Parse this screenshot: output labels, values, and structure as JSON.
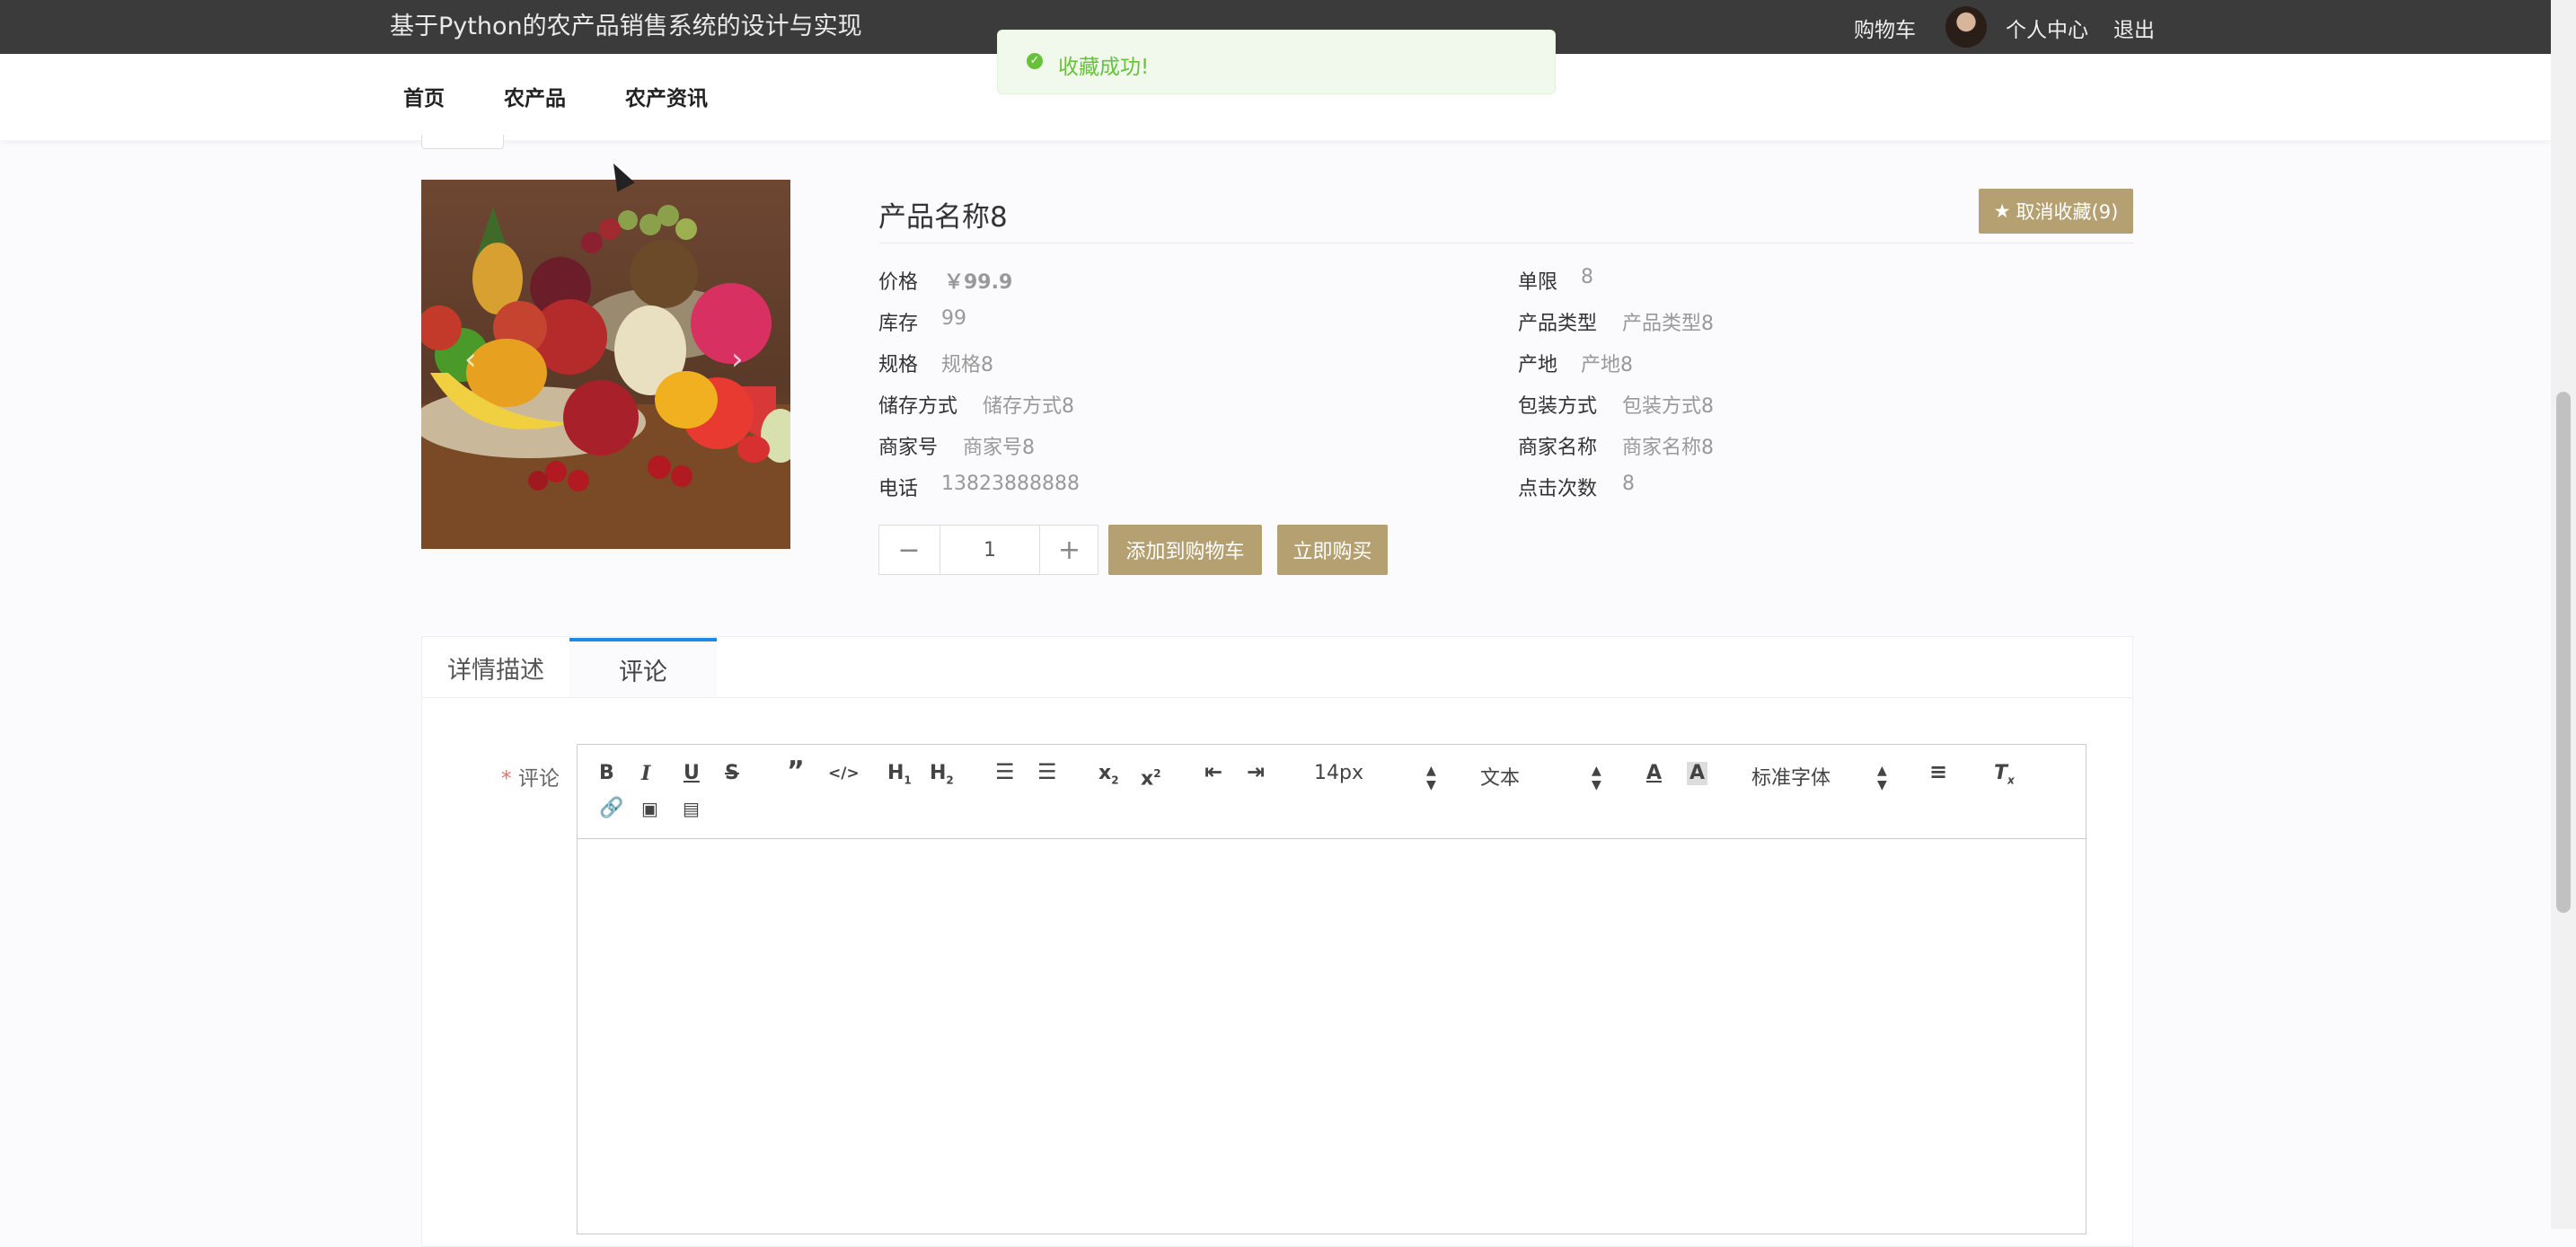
{
  "header": {
    "site_title": "基于Python的农产品销售系统的设计与实现",
    "cart": "购物车",
    "user_center": "个人中心",
    "logout": "退出"
  },
  "nav": {
    "items": [
      "首页",
      "农产品",
      "农产资讯"
    ]
  },
  "toast": {
    "message": "收藏成功!",
    "icon": "check-circle-icon"
  },
  "product": {
    "name": "产品名称8",
    "favorite_button": "取消收藏(9)",
    "attributes": [
      {
        "label": "价格",
        "value": "￥99.9"
      },
      {
        "label": "单限",
        "value": "8"
      },
      {
        "label": "库存",
        "value": "99"
      },
      {
        "label": "产品类型",
        "value": "产品类型8"
      },
      {
        "label": "规格",
        "value": "规格8"
      },
      {
        "label": "产地",
        "value": "产地8"
      },
      {
        "label": "储存方式",
        "value": "储存方式8"
      },
      {
        "label": "包装方式",
        "value": "包装方式8"
      },
      {
        "label": "商家号",
        "value": "商家号8"
      },
      {
        "label": "商家名称",
        "value": "商家名称8"
      },
      {
        "label": "电话",
        "value": "13823888888"
      },
      {
        "label": "点击次数",
        "value": "8"
      }
    ],
    "quantity": "1",
    "add_to_cart": "添加到购物车",
    "buy_now": "立即购买"
  },
  "tabs": [
    {
      "label": "详情描述",
      "active": false
    },
    {
      "label": "评论",
      "active": true
    }
  ],
  "comment": {
    "required_mark": "*",
    "label": "评论",
    "toolbar": {
      "font_size": "14px",
      "text_style": "文本",
      "font_family": "标准字体"
    }
  },
  "colors": {
    "topbar": "#3b3b3b",
    "accent_gold": "#b5a071",
    "toast_green": "#67c23a",
    "tab_active_border": "#1e88e5"
  }
}
